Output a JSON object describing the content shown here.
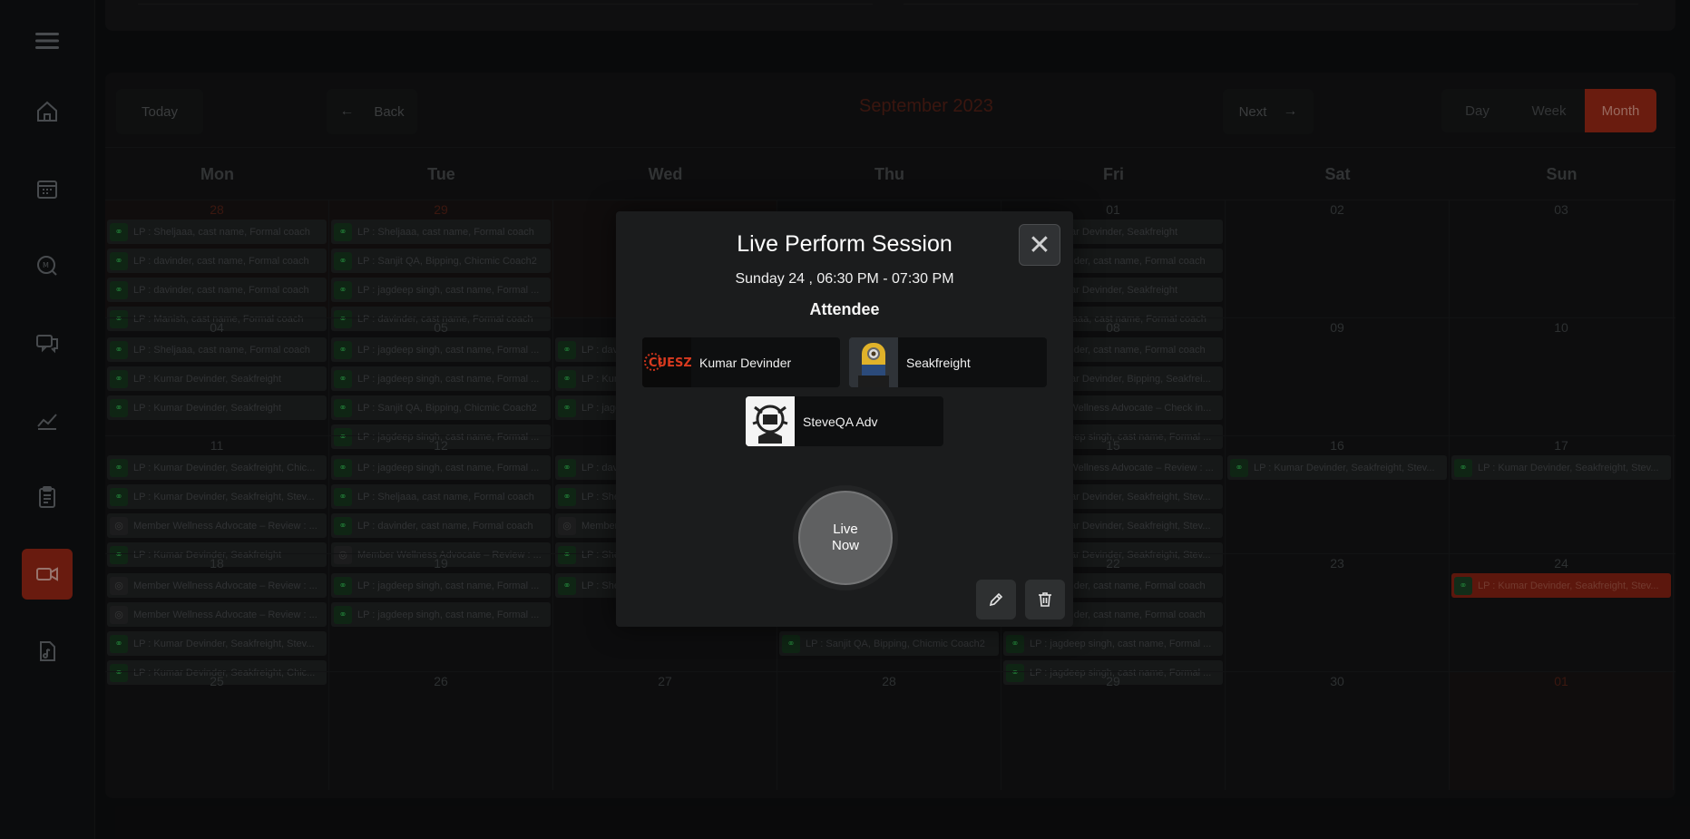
{
  "sidebar": {
    "items": [
      {
        "icon": "menu-icon"
      },
      {
        "icon": "home-icon"
      },
      {
        "icon": "calendar-icon"
      },
      {
        "icon": "message-m-icon"
      },
      {
        "icon": "chat-icon"
      },
      {
        "icon": "chart-icon"
      },
      {
        "icon": "clipboard-icon"
      },
      {
        "icon": "video-icon",
        "active": true
      },
      {
        "icon": "music-file-icon"
      }
    ]
  },
  "toolbar": {
    "today": "Today",
    "back": "Back",
    "month_title": "September 2023",
    "next": "Next",
    "views": [
      "Day",
      "Week",
      "Month"
    ],
    "active_view": "Month"
  },
  "weekdays": [
    "Mon",
    "Tue",
    "Wed",
    "Thu",
    "Fri",
    "Sat",
    "Sun"
  ],
  "weeks": [
    {
      "days": [
        {
          "num": "28",
          "off": true,
          "events": [
            "LP : Sheljaaa, cast name, Formal coach",
            "LP : davinder, cast name, Formal coach",
            "LP : davinder, cast name, Formal coach",
            "LP : Manish, cast name, Formal coach"
          ]
        },
        {
          "num": "29",
          "off": true,
          "events": [
            "LP : Sheljaaa, cast name, Formal coach",
            "LP : Sanjit QA, Bipping, Chicmic Coach2",
            "LP : jagdeep singh, cast name, Formal ...",
            "LP : davinder, cast name, Formal coach"
          ]
        },
        {
          "num": "",
          "off": true,
          "events": []
        },
        {
          "num": "",
          "off": false,
          "events": []
        },
        {
          "num": "01",
          "off": false,
          "events": [
            "LP : Kumar Devinder, Seakfreight",
            "LP : davinder, cast name, Formal coach",
            "LP : Kumar Devinder, Seakfreight",
            "LP : Sheljaaa, cast name, Formal coach"
          ]
        },
        {
          "num": "02",
          "off": false,
          "events": []
        },
        {
          "num": "03",
          "off": false,
          "events": []
        }
      ]
    },
    {
      "days": [
        {
          "num": "04",
          "events": [
            "LP : Sheljaaa, cast name, Formal coach",
            "LP : Kumar Devinder, Seakfreight",
            "LP : Kumar Devinder, Seakfreight"
          ]
        },
        {
          "num": "05",
          "events": [
            "LP : jagdeep singh, cast name, Formal ...",
            "LP : jagdeep singh, cast name, Formal ...",
            "LP : Sanjit QA, Bipping, Chicmic Coach2",
            "LP : jagdeep singh, cast name, Formal ..."
          ]
        },
        {
          "num": "",
          "events": [
            "LP : davinder",
            "LP : Kumar",
            "LP : jagdeep"
          ]
        },
        {
          "num": "",
          "events": []
        },
        {
          "num": "08",
          "events": [
            "LP : davinder, cast name, Formal coach",
            "LP : Kumar Devinder, Bipping, Seakfrei...",
            "Member Wellness Advocate – Check in...",
            "LP : jagdeep singh, cast name, Formal ..."
          ]
        },
        {
          "num": "09",
          "events": []
        },
        {
          "num": "10",
          "events": []
        }
      ]
    },
    {
      "days": [
        {
          "num": "11",
          "events": [
            "LP : Kumar Devinder, Seakfreight, Chic...",
            "LP : Kumar Devinder, Seakfreight, Stev...",
            "Member Wellness Advocate – Review : ...",
            "LP : Kumar Devinder, Seakfreight"
          ]
        },
        {
          "num": "12",
          "events": [
            "LP : jagdeep singh, cast name, Formal ...",
            "LP : Sheljaaa, cast name, Formal coach",
            "LP : davinder, cast name, Formal coach",
            "Member Wellness Advocate – Review : ..."
          ]
        },
        {
          "num": "",
          "events": [
            "LP : davinder",
            "LP : Sheljaaa",
            "Member",
            "LP : Sheljaaa"
          ]
        },
        {
          "num": "",
          "events": []
        },
        {
          "num": "15",
          "events": [
            "Member Wellness Advocate – Review : ...",
            "LP : Kumar Devinder, Seakfreight, Stev...",
            "LP : Kumar Devinder, Seakfreight, Stev...",
            "LP : Kumar Devinder, Seakfreight, Stev..."
          ]
        },
        {
          "num": "16",
          "events": [
            "LP : Kumar Devinder, Seakfreight, Stev..."
          ]
        },
        {
          "num": "17",
          "events": [
            "LP : Kumar Devinder, Seakfreight, Stev..."
          ]
        }
      ]
    },
    {
      "days": [
        {
          "num": "18",
          "events": [
            "Member Wellness Advocate – Review : ...",
            "Member Wellness Advocate – Review : ...",
            "LP : Kumar Devinder, Seakfreight, Stev...",
            "LP : Kumar Devinder, Seakfreight, Chic..."
          ]
        },
        {
          "num": "19",
          "events": [
            "LP : jagdeep singh, cast name, Formal ...",
            "LP : jagdeep singh, cast name, Formal ..."
          ]
        },
        {
          "num": "",
          "events": [
            "LP : Sheljaaa"
          ]
        },
        {
          "num": "",
          "events": [
            "LP : Sanjit QA, Bipping, Chicmic Coach2",
            "LP : Sanjit QA, Bipping, Chicmic Coach2",
            "LP : Sanjit QA, Bipping, Chicmic Coach2"
          ]
        },
        {
          "num": "22",
          "events": [
            "LP : davinder, cast name, Formal coach",
            "LP : davinder, cast name, Formal coach",
            "LP : jagdeep singh, cast name, Formal ...",
            "LP : jagdeep singh, cast name, Formal ..."
          ]
        },
        {
          "num": "23",
          "events": []
        },
        {
          "num": "24",
          "events": [
            "LP : Kumar Devinder, Seakfreight, Stev..."
          ],
          "highlight": true
        }
      ]
    },
    {
      "days": [
        {
          "num": "25",
          "events": []
        },
        {
          "num": "26",
          "events": []
        },
        {
          "num": "27",
          "events": []
        },
        {
          "num": "28",
          "events": []
        },
        {
          "num": "29",
          "events": []
        },
        {
          "num": "30",
          "events": []
        },
        {
          "num": "01",
          "events": [],
          "off": true
        }
      ]
    }
  ],
  "modal": {
    "title": "Live Perform Session",
    "time": "Sunday 24 , 06:30 PM - 07:30 PM",
    "attendee_heading": "Attendee",
    "attendees": [
      {
        "name": "Kumar Devinder",
        "avatar": "cuesz-logo-avatar"
      },
      {
        "name": "Seakfreight",
        "avatar": "minion-avatar"
      },
      {
        "name": "SteveQA Adv",
        "avatar": "emblem-avatar"
      }
    ],
    "live_line1": "Live",
    "live_line2": "Now",
    "close_icon": "close-icon",
    "edit_icon": "pencil-icon",
    "delete_icon": "trash-icon"
  },
  "colors": {
    "accent": "#a42b18",
    "event_icon": "#2fa64b"
  }
}
